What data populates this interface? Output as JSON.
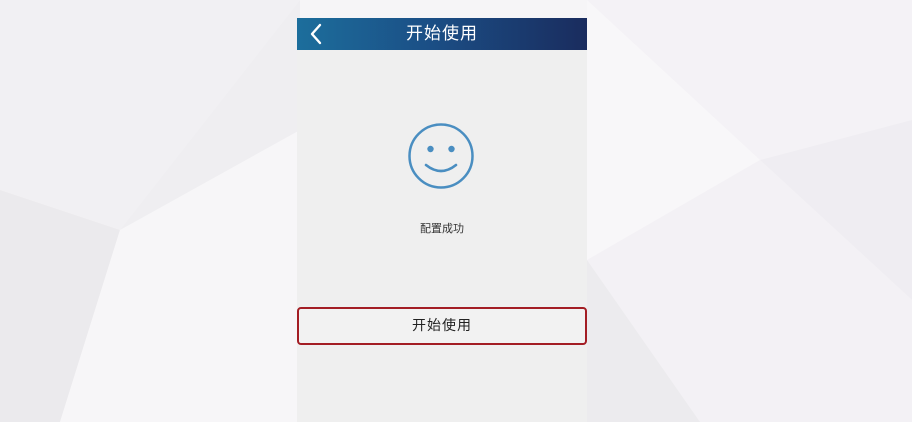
{
  "header": {
    "title": "开始使用",
    "back_icon": "chevron-left-icon"
  },
  "main": {
    "status_icon": "smiley-icon",
    "status_text": "配置成功",
    "start_button_label": "开始使用"
  },
  "colors": {
    "header_start": "#1c6e9c",
    "header_end": "#1a2c5e",
    "icon_blue": "#4a8ec1",
    "highlight_border": "#a31d24"
  }
}
